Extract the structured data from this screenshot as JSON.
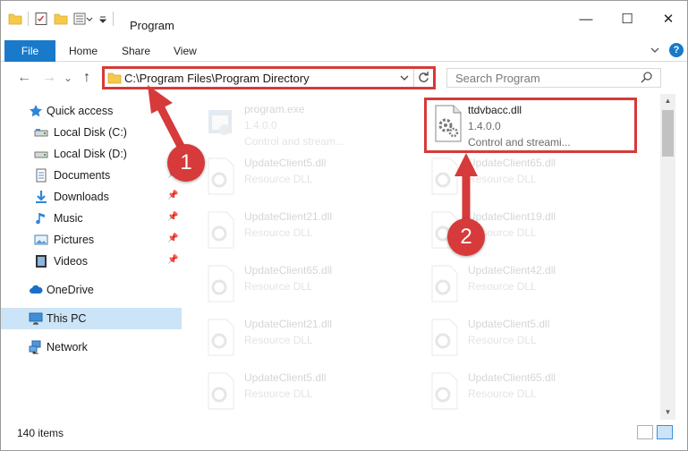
{
  "window": {
    "title": "Program",
    "minimize_glyph": "—",
    "maximize_glyph": "☐",
    "close_glyph": "✕"
  },
  "ribbon": {
    "tabs": [
      "File",
      "Home",
      "Share",
      "View"
    ]
  },
  "navigation": {
    "back_glyph": "←",
    "forward_glyph": "→",
    "recent_glyph": "⌄",
    "up_glyph": "↑",
    "address": "C:\\Program Files\\Program Directory",
    "search_placeholder": "Search Program"
  },
  "sidebar": {
    "items": [
      {
        "label": "Quick access",
        "icon": "star-icon"
      },
      {
        "label": "Local Disk (C:)",
        "icon": "drive-icon"
      },
      {
        "label": "Local Disk (D:)",
        "icon": "drive-icon"
      },
      {
        "label": "Documents",
        "icon": "documents-icon",
        "pinned": true
      },
      {
        "label": "Downloads",
        "icon": "download-icon",
        "pinned": true
      },
      {
        "label": "Music",
        "icon": "music-icon",
        "pinned": true
      },
      {
        "label": "Pictures",
        "icon": "pictures-icon",
        "pinned": true
      },
      {
        "label": "Videos",
        "icon": "videos-icon",
        "pinned": true
      },
      {
        "label": "OneDrive",
        "icon": "cloud-icon"
      },
      {
        "label": "This PC",
        "icon": "computer-icon",
        "selected": true
      },
      {
        "label": "Network",
        "icon": "network-icon"
      }
    ]
  },
  "files": [
    {
      "name": "program.exe",
      "line2": "1.4.0.0",
      "line3": "Control and stream...",
      "kind": "exe",
      "faded": true
    },
    {
      "name": "ttdvbacc.dll",
      "line2": "1.4.0.0",
      "line3": "Control and streami...",
      "kind": "dll",
      "highlight": true
    },
    {
      "name": "UpdateClient5.dll",
      "line2": "Resource DLL",
      "kind": "dll",
      "faded": true
    },
    {
      "name": "UpdateClient65.dll",
      "line2": "Resource DLL",
      "kind": "dll",
      "faded": true
    },
    {
      "name": "UpdateClient21.dll",
      "line2": "Resource DLL",
      "kind": "dll",
      "faded": true
    },
    {
      "name": "UpdateClient19.dll",
      "line2": "Resource DLL",
      "kind": "dll",
      "faded": true
    },
    {
      "name": "UpdateClient65.dll",
      "line2": "Resource DLL",
      "kind": "dll",
      "faded": true
    },
    {
      "name": "UpdateClient42.dll",
      "line2": "Resource DLL",
      "kind": "dll",
      "faded": true
    },
    {
      "name": "UpdateClient21.dll",
      "line2": "Resource DLL",
      "kind": "dll",
      "faded": true
    },
    {
      "name": "UpdateClient5.dll",
      "line2": "Resource DLL",
      "kind": "dll",
      "faded": true
    },
    {
      "name": "UpdateClient5.dll",
      "line2": "Resource DLL",
      "kind": "dll",
      "faded": true
    },
    {
      "name": "UpdateClient65.dll",
      "line2": "Resource DLL",
      "kind": "dll",
      "faded": true
    }
  ],
  "status": {
    "item_count": "140 items"
  },
  "callouts": [
    {
      "number": "1"
    },
    {
      "number": "2"
    }
  ],
  "colors": {
    "accent": "#1979ca",
    "highlight_red": "#d63a3a",
    "selection": "#cce4f7"
  }
}
